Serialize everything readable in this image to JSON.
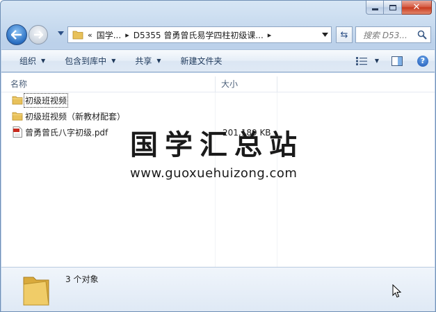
{
  "address_bar": {
    "overflow_glyph": "«",
    "crumbs": [
      "国学...",
      "D5355 曾勇曾氏易学四柱初级课..."
    ],
    "search_placeholder": "搜索 D53..."
  },
  "command_bar": {
    "organize": "组织",
    "include_in_library": "包含到库中",
    "share": "共享",
    "new_folder": "新建文件夹"
  },
  "columns": {
    "name": "名称",
    "size": "大小"
  },
  "files": [
    {
      "name": "初级班视频",
      "size": "",
      "icon": "folder-icon"
    },
    {
      "name": "初级班视频（新教材配套）",
      "size": "",
      "icon": "folder-icon"
    },
    {
      "name": "曾勇曾氏八字初级.pdf",
      "size": "201,189 KB",
      "icon": "pdf-file-icon"
    }
  ],
  "watermark": {
    "title": "国学汇总站",
    "url": "www.guoxuehuizong.com"
  },
  "details_pane": {
    "item_count": "3 个对象"
  },
  "colors": {
    "accent": "#1c55b4",
    "folder": "#e8c15a",
    "pdf": "#c82a1e"
  }
}
